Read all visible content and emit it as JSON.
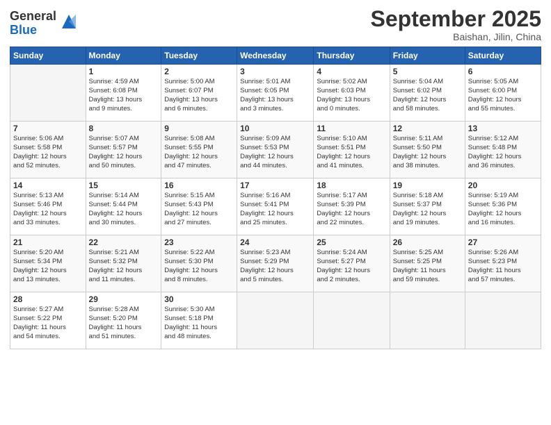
{
  "header": {
    "title": "September 2025",
    "location": "Baishan, Jilin, China"
  },
  "columns": [
    "Sunday",
    "Monday",
    "Tuesday",
    "Wednesday",
    "Thursday",
    "Friday",
    "Saturday"
  ],
  "weeks": [
    [
      {
        "day": "",
        "info": ""
      },
      {
        "day": "1",
        "info": "Sunrise: 4:59 AM\nSunset: 6:08 PM\nDaylight: 13 hours\nand 9 minutes."
      },
      {
        "day": "2",
        "info": "Sunrise: 5:00 AM\nSunset: 6:07 PM\nDaylight: 13 hours\nand 6 minutes."
      },
      {
        "day": "3",
        "info": "Sunrise: 5:01 AM\nSunset: 6:05 PM\nDaylight: 13 hours\nand 3 minutes."
      },
      {
        "day": "4",
        "info": "Sunrise: 5:02 AM\nSunset: 6:03 PM\nDaylight: 13 hours\nand 0 minutes."
      },
      {
        "day": "5",
        "info": "Sunrise: 5:04 AM\nSunset: 6:02 PM\nDaylight: 12 hours\nand 58 minutes."
      },
      {
        "day": "6",
        "info": "Sunrise: 5:05 AM\nSunset: 6:00 PM\nDaylight: 12 hours\nand 55 minutes."
      }
    ],
    [
      {
        "day": "7",
        "info": "Sunrise: 5:06 AM\nSunset: 5:58 PM\nDaylight: 12 hours\nand 52 minutes."
      },
      {
        "day": "8",
        "info": "Sunrise: 5:07 AM\nSunset: 5:57 PM\nDaylight: 12 hours\nand 50 minutes."
      },
      {
        "day": "9",
        "info": "Sunrise: 5:08 AM\nSunset: 5:55 PM\nDaylight: 12 hours\nand 47 minutes."
      },
      {
        "day": "10",
        "info": "Sunrise: 5:09 AM\nSunset: 5:53 PM\nDaylight: 12 hours\nand 44 minutes."
      },
      {
        "day": "11",
        "info": "Sunrise: 5:10 AM\nSunset: 5:51 PM\nDaylight: 12 hours\nand 41 minutes."
      },
      {
        "day": "12",
        "info": "Sunrise: 5:11 AM\nSunset: 5:50 PM\nDaylight: 12 hours\nand 38 minutes."
      },
      {
        "day": "13",
        "info": "Sunrise: 5:12 AM\nSunset: 5:48 PM\nDaylight: 12 hours\nand 36 minutes."
      }
    ],
    [
      {
        "day": "14",
        "info": "Sunrise: 5:13 AM\nSunset: 5:46 PM\nDaylight: 12 hours\nand 33 minutes."
      },
      {
        "day": "15",
        "info": "Sunrise: 5:14 AM\nSunset: 5:44 PM\nDaylight: 12 hours\nand 30 minutes."
      },
      {
        "day": "16",
        "info": "Sunrise: 5:15 AM\nSunset: 5:43 PM\nDaylight: 12 hours\nand 27 minutes."
      },
      {
        "day": "17",
        "info": "Sunrise: 5:16 AM\nSunset: 5:41 PM\nDaylight: 12 hours\nand 25 minutes."
      },
      {
        "day": "18",
        "info": "Sunrise: 5:17 AM\nSunset: 5:39 PM\nDaylight: 12 hours\nand 22 minutes."
      },
      {
        "day": "19",
        "info": "Sunrise: 5:18 AM\nSunset: 5:37 PM\nDaylight: 12 hours\nand 19 minutes."
      },
      {
        "day": "20",
        "info": "Sunrise: 5:19 AM\nSunset: 5:36 PM\nDaylight: 12 hours\nand 16 minutes."
      }
    ],
    [
      {
        "day": "21",
        "info": "Sunrise: 5:20 AM\nSunset: 5:34 PM\nDaylight: 12 hours\nand 13 minutes."
      },
      {
        "day": "22",
        "info": "Sunrise: 5:21 AM\nSunset: 5:32 PM\nDaylight: 12 hours\nand 11 minutes."
      },
      {
        "day": "23",
        "info": "Sunrise: 5:22 AM\nSunset: 5:30 PM\nDaylight: 12 hours\nand 8 minutes."
      },
      {
        "day": "24",
        "info": "Sunrise: 5:23 AM\nSunset: 5:29 PM\nDaylight: 12 hours\nand 5 minutes."
      },
      {
        "day": "25",
        "info": "Sunrise: 5:24 AM\nSunset: 5:27 PM\nDaylight: 12 hours\nand 2 minutes."
      },
      {
        "day": "26",
        "info": "Sunrise: 5:25 AM\nSunset: 5:25 PM\nDaylight: 11 hours\nand 59 minutes."
      },
      {
        "day": "27",
        "info": "Sunrise: 5:26 AM\nSunset: 5:23 PM\nDaylight: 11 hours\nand 57 minutes."
      }
    ],
    [
      {
        "day": "28",
        "info": "Sunrise: 5:27 AM\nSunset: 5:22 PM\nDaylight: 11 hours\nand 54 minutes."
      },
      {
        "day": "29",
        "info": "Sunrise: 5:28 AM\nSunset: 5:20 PM\nDaylight: 11 hours\nand 51 minutes."
      },
      {
        "day": "30",
        "info": "Sunrise: 5:30 AM\nSunset: 5:18 PM\nDaylight: 11 hours\nand 48 minutes."
      },
      {
        "day": "",
        "info": ""
      },
      {
        "day": "",
        "info": ""
      },
      {
        "day": "",
        "info": ""
      },
      {
        "day": "",
        "info": ""
      }
    ]
  ]
}
